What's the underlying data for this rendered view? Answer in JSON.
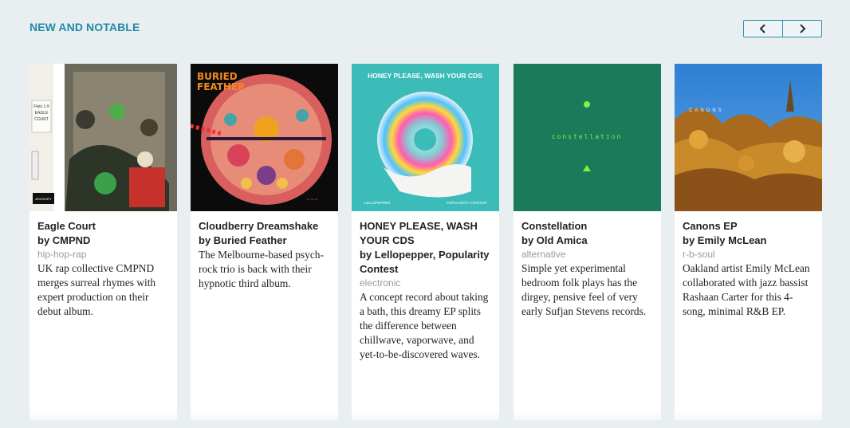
{
  "section": {
    "title": "NEW AND NOTABLE"
  },
  "pager": {
    "prev_icon": "chevron-left-icon",
    "next_icon": "chevron-right-icon"
  },
  "cards": [
    {
      "title": "Eagle Court",
      "artist": "by CMPND",
      "genre": "hip-hop-rap",
      "description": "UK rap collective CMPND merges surreal rhymes with expert production on their debut album."
    },
    {
      "title": "Cloudberry Dreamshake",
      "artist": "by Buried Feather",
      "genre": "",
      "description": "The Melbourne-based psych-rock trio is back with their hypnotic third album."
    },
    {
      "title": "HONEY PLEASE, WASH YOUR CDS",
      "artist": "by Lellopepper, Popularity Contest",
      "genre": "electronic",
      "description": "A concept record about taking a bath, this dreamy EP splits the difference between chillwave, vaporwave, and yet-to-be-discovered waves."
    },
    {
      "title": "Constellation",
      "artist": "by Old Amica",
      "genre": "alternative",
      "description": "Simple yet experimental bedroom folk plays has the dirgey, pensive feel of very early Sufjan Stevens records."
    },
    {
      "title": "Canons EP",
      "artist": "by Emily McLean",
      "genre": "r-b-soul",
      "description": "Oakland artist Emily McLean collaborated with jazz bassist Rashaan Carter for this 4-song, minimal R&B EP."
    }
  ],
  "art": {
    "eagle_court_sign": "Flats 1-9 EAGLE COURT",
    "honey_banner": "HONEY PLEASE, WASH YOUR CDS",
    "honey_left": "LELLOPEPPER",
    "honey_right": "POPULARITY CONTEST",
    "constellation_word": "constellation",
    "canons_word": "CANONS",
    "buried_logo": "BURIED FEATHER"
  },
  "colors": {
    "accent": "#1f8aa6",
    "background": "#e9eff1",
    "card": "#ffffff"
  }
}
